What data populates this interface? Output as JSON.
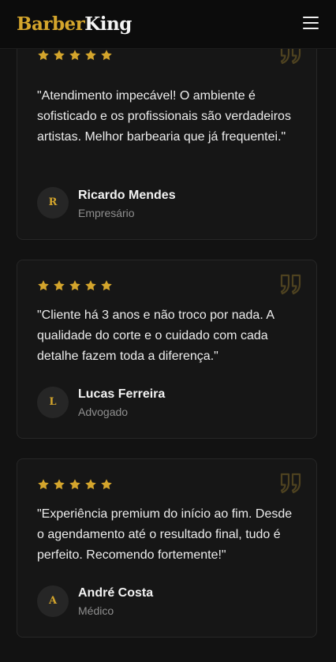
{
  "header": {
    "logo_part1": "Barber",
    "logo_part2": "King",
    "menu_icon": "hamburger-menu-icon"
  },
  "colors": {
    "accent": "#d4a52c",
    "background": "#121212",
    "card_background": "#161616",
    "card_border": "#272727",
    "avatar_background": "#262626",
    "muted_text": "#8f8f8f"
  },
  "testimonials": [
    {
      "rating": 5,
      "text": "\"Atendimento impecável! O ambiente é sofisticado e os profissionais são verdadeiros artistas. Melhor barbearia que já frequentei.\"",
      "initial": "R",
      "name": "Ricardo Mendes",
      "role": "Empresário"
    },
    {
      "rating": 5,
      "text": "\"Cliente há 3 anos e não troco por nada. A qualidade do corte e o cuidado com cada detalhe fazem toda a diferença.\"",
      "initial": "L",
      "name": "Lucas Ferreira",
      "role": "Advogado"
    },
    {
      "rating": 5,
      "text": "\"Experiência premium do início ao fim. Desde o agendamento até o resultado final, tudo é perfeito. Recomendo fortemente!\"",
      "initial": "A",
      "name": "André Costa",
      "role": "Médico"
    }
  ]
}
